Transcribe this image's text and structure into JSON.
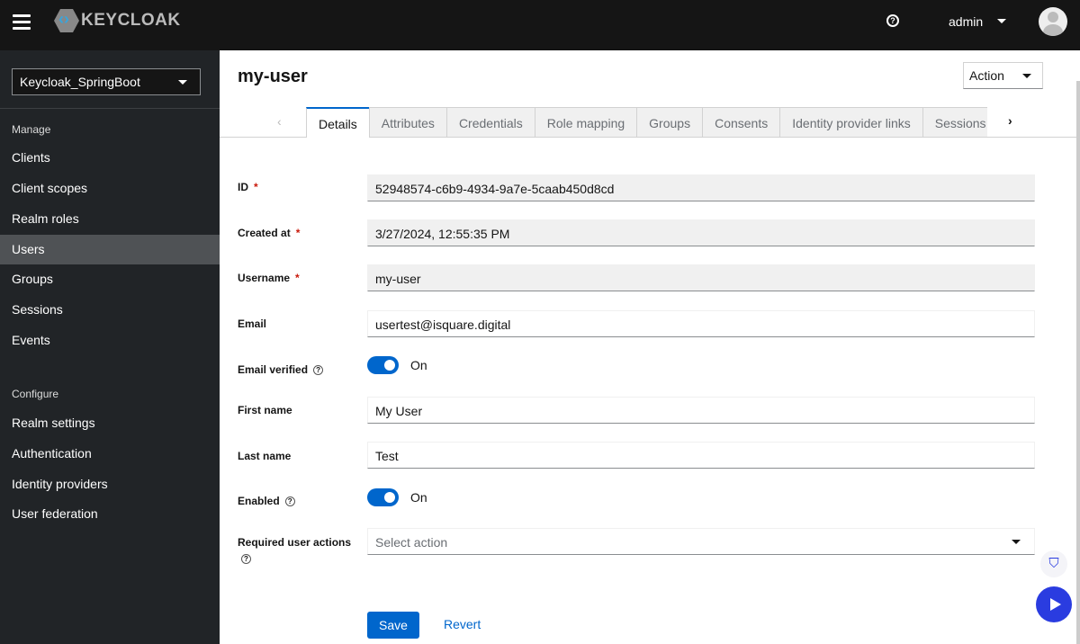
{
  "header": {
    "brand": "KEYCLOAK",
    "user": "admin"
  },
  "sidebar": {
    "realm": "Keycloak_SpringBoot",
    "manage_label": "Manage",
    "configure_label": "Configure",
    "manage": [
      {
        "label": "Clients"
      },
      {
        "label": "Client scopes"
      },
      {
        "label": "Realm roles"
      },
      {
        "label": "Users"
      },
      {
        "label": "Groups"
      },
      {
        "label": "Sessions"
      },
      {
        "label": "Events"
      }
    ],
    "configure": [
      {
        "label": "Realm settings"
      },
      {
        "label": "Authentication"
      },
      {
        "label": "Identity providers"
      },
      {
        "label": "User federation"
      }
    ],
    "active": "Users"
  },
  "page": {
    "title": "my-user",
    "action": "Action",
    "tabs": [
      "Details",
      "Attributes",
      "Credentials",
      "Role mapping",
      "Groups",
      "Consents",
      "Identity provider links",
      "Sessions"
    ]
  },
  "form": {
    "id": {
      "label": "ID",
      "value": "52948574-c6b9-4934-9a7e-5caab450d8cd"
    },
    "created": {
      "label": "Created at",
      "value": "3/27/2024, 12:55:35 PM"
    },
    "username": {
      "label": "Username",
      "value": "my-user"
    },
    "email": {
      "label": "Email",
      "value": "usertest@isquare.digital"
    },
    "email_verified": {
      "label": "Email verified",
      "value": "On"
    },
    "first_name": {
      "label": "First name",
      "value": "My User"
    },
    "last_name": {
      "label": "Last name",
      "value": "Test"
    },
    "enabled": {
      "label": "Enabled",
      "value": "On"
    },
    "required_actions": {
      "label": "Required user actions",
      "placeholder": "Select action"
    },
    "save": "Save",
    "revert": "Revert"
  }
}
